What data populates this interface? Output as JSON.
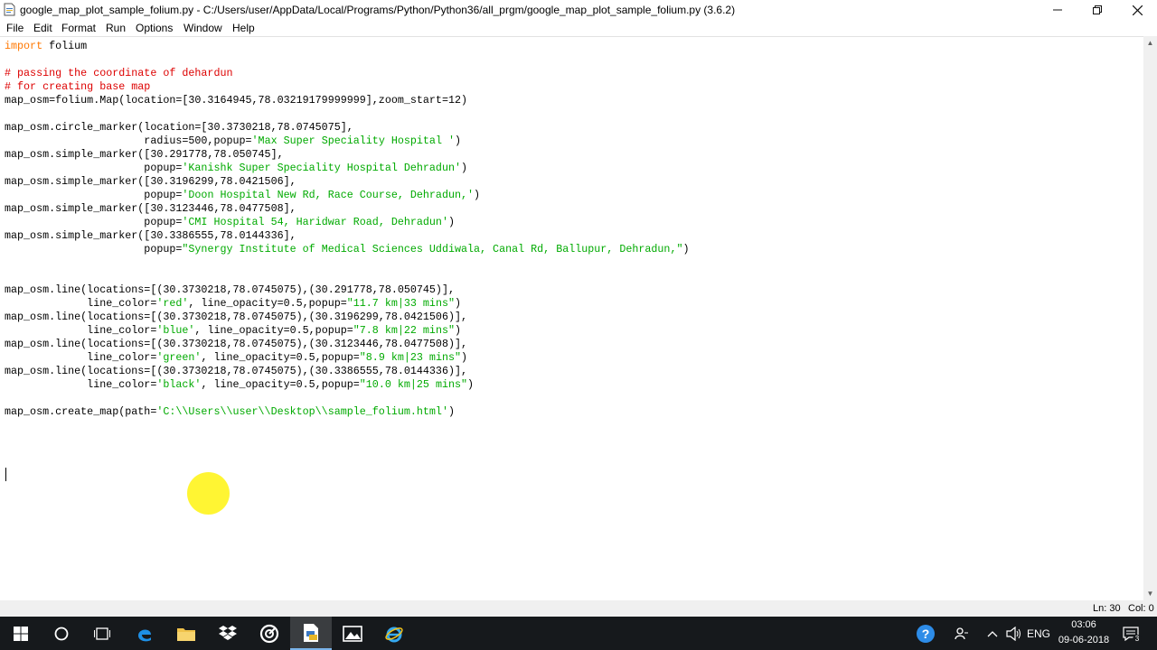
{
  "window": {
    "title": "google_map_plot_sample_folium.py - C:/Users/user/AppData/Local/Programs/Python/Python36/all_prgm/google_map_plot_sample_folium.py (3.6.2)"
  },
  "menu": {
    "items": [
      "File",
      "Edit",
      "Format",
      "Run",
      "Options",
      "Window",
      "Help"
    ]
  },
  "editor": {
    "lines": [
      [
        {
          "t": "import",
          "c": "kw"
        },
        {
          "t": " folium"
        }
      ],
      [
        {
          "t": ""
        }
      ],
      [
        {
          "t": "# passing the coordinate of dehardun",
          "c": "cm"
        }
      ],
      [
        {
          "t": "# for creating base map",
          "c": "cm"
        }
      ],
      [
        {
          "t": "map_osm=folium.Map(location=[30.3164945,78.03219179999999],zoom_start=12)"
        }
      ],
      [
        {
          "t": ""
        }
      ],
      [
        {
          "t": "map_osm.circle_marker(location=[30.3730218,78.0745075],"
        }
      ],
      [
        {
          "t": "                      radius=500,popup="
        },
        {
          "t": "'Max Super Speciality Hospital '",
          "c": "st"
        },
        {
          "t": ")"
        }
      ],
      [
        {
          "t": "map_osm.simple_marker([30.291778,78.050745],"
        }
      ],
      [
        {
          "t": "                      popup="
        },
        {
          "t": "'Kanishk Super Speciality Hospital Dehradun'",
          "c": "st"
        },
        {
          "t": ")"
        }
      ],
      [
        {
          "t": "map_osm.simple_marker([30.3196299,78.0421506],"
        }
      ],
      [
        {
          "t": "                      popup="
        },
        {
          "t": "'Doon Hospital New Rd, Race Course, Dehradun,'",
          "c": "st"
        },
        {
          "t": ")"
        }
      ],
      [
        {
          "t": "map_osm.simple_marker([30.3123446,78.0477508],"
        }
      ],
      [
        {
          "t": "                      popup="
        },
        {
          "t": "'CMI Hospital 54, Haridwar Road, Dehradun'",
          "c": "st"
        },
        {
          "t": ")"
        }
      ],
      [
        {
          "t": "map_osm.simple_marker([30.3386555,78.0144336],"
        }
      ],
      [
        {
          "t": "                      popup="
        },
        {
          "t": "\"Synergy Institute of Medical Sciences Uddiwala, Canal Rd, Ballupur, Dehradun,\"",
          "c": "st"
        },
        {
          "t": ")"
        }
      ],
      [
        {
          "t": ""
        }
      ],
      [
        {
          "t": ""
        }
      ],
      [
        {
          "t": "map_osm.line(locations=[(30.3730218,78.0745075),(30.291778,78.050745)],"
        }
      ],
      [
        {
          "t": "             line_color="
        },
        {
          "t": "'red'",
          "c": "st"
        },
        {
          "t": ", line_opacity=0.5,popup="
        },
        {
          "t": "\"11.7 km|33 mins\"",
          "c": "st"
        },
        {
          "t": ")"
        }
      ],
      [
        {
          "t": "map_osm.line(locations=[(30.3730218,78.0745075),(30.3196299,78.0421506)],"
        }
      ],
      [
        {
          "t": "             line_color="
        },
        {
          "t": "'blue'",
          "c": "st"
        },
        {
          "t": ", line_opacity=0.5,popup="
        },
        {
          "t": "\"7.8 km|22 mins\"",
          "c": "st"
        },
        {
          "t": ")"
        }
      ],
      [
        {
          "t": "map_osm.line(locations=[(30.3730218,78.0745075),(30.3123446,78.0477508)],"
        }
      ],
      [
        {
          "t": "             line_color="
        },
        {
          "t": "'green'",
          "c": "st"
        },
        {
          "t": ", line_opacity=0.5,popup="
        },
        {
          "t": "\"8.9 km|23 mins\"",
          "c": "st"
        },
        {
          "t": ")"
        }
      ],
      [
        {
          "t": "map_osm.line(locations=[(30.3730218,78.0745075),(30.3386555,78.0144336)],"
        }
      ],
      [
        {
          "t": "             line_color="
        },
        {
          "t": "'black'",
          "c": "st"
        },
        {
          "t": ", line_opacity=0.5,popup="
        },
        {
          "t": "\"10.0 km|25 mins\"",
          "c": "st"
        },
        {
          "t": ")"
        }
      ],
      [
        {
          "t": ""
        }
      ],
      [
        {
          "t": "map_osm.create_map(path="
        },
        {
          "t": "'C:\\\\Users\\\\user\\\\Desktop\\\\sample_folium.html'",
          "c": "st"
        },
        {
          "t": ")"
        }
      ],
      [
        {
          "t": ""
        }
      ],
      [
        {
          "t": ""
        }
      ]
    ]
  },
  "statusbar": {
    "line": "Ln: 30",
    "col": "Col: 0"
  },
  "taskbar": {
    "apps": [
      "start-icon",
      "cortana-icon",
      "task-view-icon",
      "edge-icon",
      "file-explorer-icon",
      "dropbox-icon",
      "chrome-like-icon",
      "python-idle-icon",
      "photos-icon",
      "internet-explorer-icon"
    ],
    "language": "ENG",
    "time": "03:06",
    "date": "09-06-2018",
    "notifications": "3"
  },
  "colors": {
    "keyword": "#ff7700",
    "comment": "#dd0000",
    "string": "#00aa00",
    "taskbar": "#16191c",
    "cursor_highlight": "#fff200"
  }
}
